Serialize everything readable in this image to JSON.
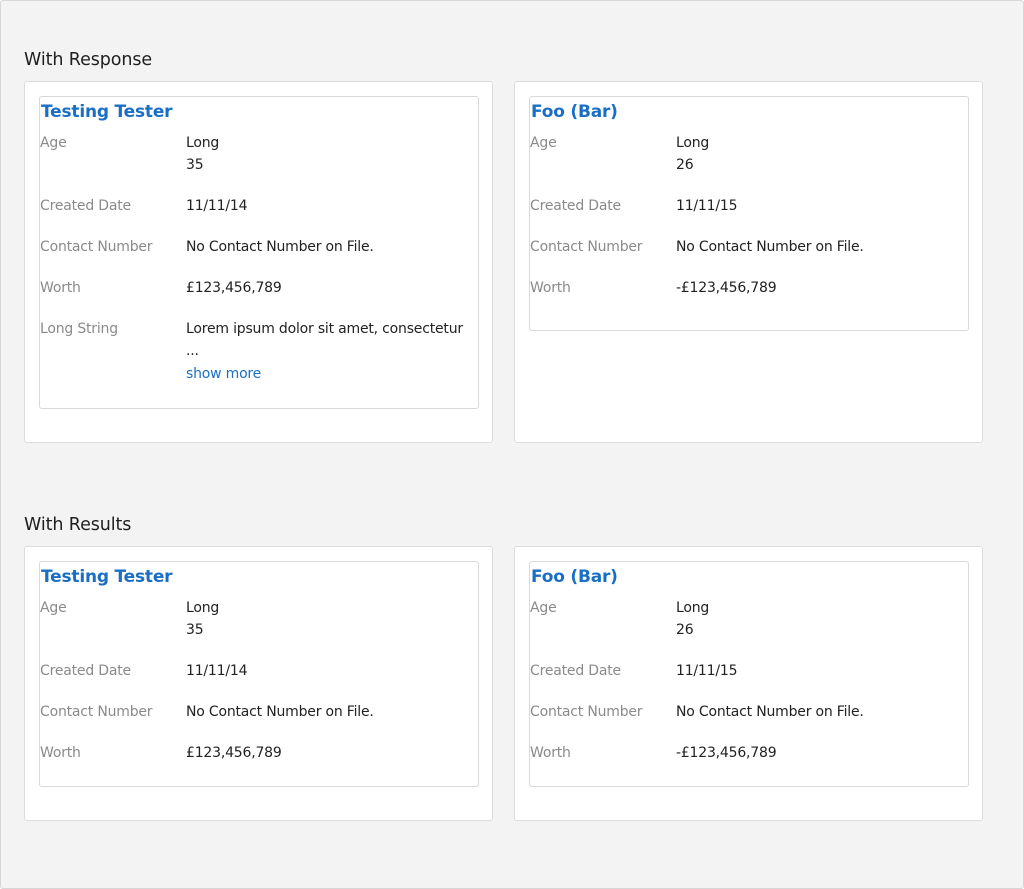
{
  "sections": [
    {
      "title": "With Response",
      "cards": [
        {
          "title": "Testing Tester",
          "fields": [
            {
              "label": "Age",
              "value_line1": "Long",
              "value_line2": "35"
            },
            {
              "label": "Created Date",
              "value": "11/11/14"
            },
            {
              "label": "Contact Number",
              "value": "No Contact Number on File."
            },
            {
              "label": "Worth",
              "value": "£123,456,789"
            },
            {
              "label": "Long String",
              "value_line1": "Lorem ipsum dolor sit amet, consectetur",
              "value_line2": "...",
              "show_more": "show more"
            }
          ]
        },
        {
          "title": "Foo (Bar)",
          "fields": [
            {
              "label": "Age",
              "value_line1": "Long",
              "value_line2": "26"
            },
            {
              "label": "Created Date",
              "value": "11/11/15"
            },
            {
              "label": "Contact Number",
              "value": "No Contact Number on File."
            },
            {
              "label": "Worth",
              "value": "-£123,456,789"
            }
          ]
        }
      ]
    },
    {
      "title": "With Results",
      "cards": [
        {
          "title": "Testing Tester",
          "fields": [
            {
              "label": "Age",
              "value_line1": "Long",
              "value_line2": "35"
            },
            {
              "label": "Created Date",
              "value": "11/11/14"
            },
            {
              "label": "Contact Number",
              "value": "No Contact Number on File."
            },
            {
              "label": "Worth",
              "value": "£123,456,789"
            }
          ]
        },
        {
          "title": "Foo (Bar)",
          "fields": [
            {
              "label": "Age",
              "value_line1": "Long",
              "value_line2": "26"
            },
            {
              "label": "Created Date",
              "value": "11/11/15"
            },
            {
              "label": "Contact Number",
              "value": "No Contact Number on File."
            },
            {
              "label": "Worth",
              "value": "-£123,456,789"
            }
          ]
        }
      ]
    }
  ],
  "colors": {
    "page_background": "#f3f3f3",
    "card_background": "#ffffff",
    "border": "#dcdcdc",
    "title_link": "#1a6fc4",
    "label_text": "#8a8a8a",
    "value_text": "#222222"
  }
}
